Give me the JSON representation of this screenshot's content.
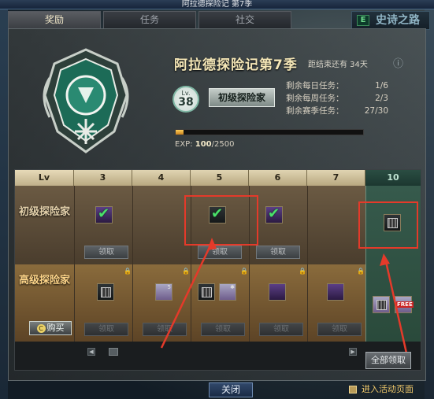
{
  "window": {
    "title": "阿拉德探险记 第7季"
  },
  "tabs": [
    {
      "label": "奖励",
      "active": true
    },
    {
      "label": "任务",
      "active": false
    },
    {
      "label": "社交",
      "active": false
    }
  ],
  "top_right": {
    "label": "史诗之路"
  },
  "season": {
    "title": "阿拉德探险记第7季",
    "countdown": "距结束还有 34天",
    "level_label": "Lv.",
    "level": "38",
    "rank": "初级探险家"
  },
  "quests": [
    {
      "label": "剩余每日任务：",
      "value": "1/6"
    },
    {
      "label": "剩余每周任务：",
      "value": "2/3"
    },
    {
      "label": "剩余赛季任务：",
      "value": "27/30"
    }
  ],
  "exp": {
    "label": "EXP:",
    "current": "100",
    "max": "/2500",
    "progress": 0.04
  },
  "grid": {
    "lv_header": "Lv",
    "columns": [
      "3",
      "4",
      "5",
      "6",
      "7",
      "10"
    ],
    "rows": {
      "basic": "初级探险家",
      "advanced": "高级探险家"
    },
    "claim_label": "领取",
    "buy_label": "购买",
    "claim_all_label": "全部领取"
  },
  "footer": {
    "close_label": "关闭",
    "event_link": "进入活动页面"
  },
  "colors": {
    "highlight": "#e43a2a",
    "check": "#4ae06a",
    "exp_fill": "#ffcf5a"
  }
}
